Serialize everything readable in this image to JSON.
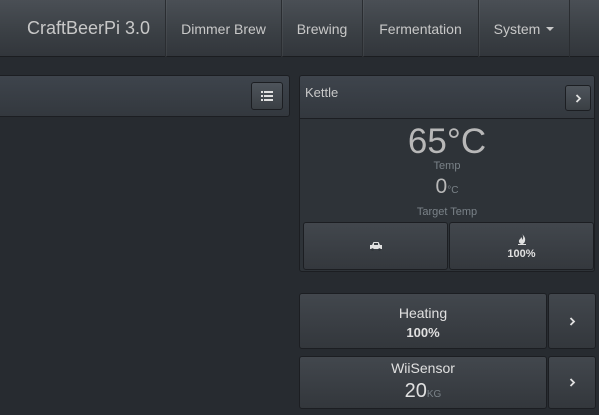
{
  "navbar": {
    "brand": "CraftBeerPi 3.0",
    "items": [
      {
        "label": "Dimmer Brew"
      },
      {
        "label": "Brewing"
      },
      {
        "label": "Fermentation"
      },
      {
        "label": "System"
      }
    ]
  },
  "left_panel": {
    "button_icon": "list-icon"
  },
  "kettle": {
    "title": "Kettle",
    "temp": "65°C",
    "temp_label": "Temp",
    "target_value": "0",
    "target_unit": "°C",
    "target_label": "Target Temp",
    "buttons": [
      {
        "icon": "car-icon",
        "label": ""
      },
      {
        "icon": "fire-icon",
        "label": "100%"
      }
    ],
    "expand_icon": "chevron-right-icon"
  },
  "heating": {
    "label": "Heating",
    "value": "100%",
    "arrow_icon": "chevron-right-icon"
  },
  "wiisensor": {
    "label": "WiiSensor",
    "value": "20",
    "unit": "KG",
    "arrow_icon": "chevron-right-icon"
  },
  "colors": {
    "background": "#272b30",
    "panel": "#2e3338",
    "text": "#c8c8c8",
    "muted": "#7a8288"
  }
}
